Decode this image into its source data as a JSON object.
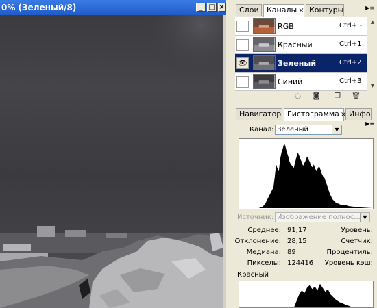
{
  "document": {
    "title": "0% (Зеленый/8)",
    "btn_min": "_",
    "btn_max": "□",
    "btn_close": "×"
  },
  "channels_panel": {
    "tabs": [
      {
        "label": "Слои"
      },
      {
        "label": "Каналы",
        "close": "×"
      },
      {
        "label": "Контуры"
      }
    ],
    "menu_glyph": "▶≡",
    "rows": [
      {
        "name": "RGB",
        "shortcut": "Ctrl+~",
        "visible": false
      },
      {
        "name": "Красный",
        "shortcut": "Ctrl+1",
        "visible": false
      },
      {
        "name": "Зеленый",
        "shortcut": "Ctrl+2",
        "visible": true,
        "eye": "👁"
      },
      {
        "name": "Синий",
        "shortcut": "Ctrl+3",
        "visible": false
      }
    ],
    "scroll_up": "▲",
    "scroll_down": "▼"
  },
  "histogram_panel": {
    "tabs": [
      {
        "label": "Навигатор"
      },
      {
        "label": "Гистограмма",
        "close": "×"
      },
      {
        "label": "Инфо"
      }
    ],
    "menu_glyph": "▶≡",
    "channel_label": "Канал:",
    "channel_value": "Зеленый",
    "source_label": "Источник:",
    "source_value": "Изображение полнос...",
    "stats": {
      "mean_label": "Среднее:",
      "mean": "91,17",
      "std_label": "Отклонение:",
      "std": "28,15",
      "median_label": "Медиана:",
      "median": "89",
      "pixels_label": "Пикселы:",
      "pixels": "124416",
      "level_label": "Уровень:",
      "count_label": "Счетчик:",
      "percentile_label": "Процентиль:",
      "cache_label": "Уровень кэш:"
    },
    "red_label": "Красный",
    "dropdown_glyph": "▼"
  },
  "colors": {
    "titlebar": "#1f5bc8",
    "selection": "#0a246a",
    "panel_bg": "#ece9d8"
  }
}
